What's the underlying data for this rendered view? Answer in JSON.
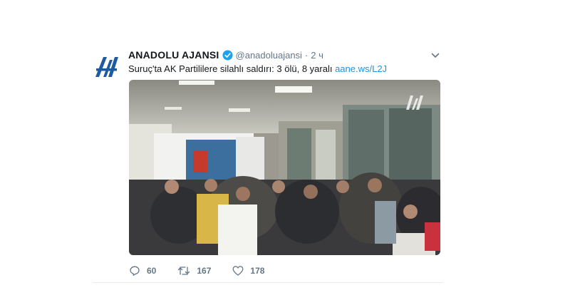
{
  "tweet": {
    "name": "ANADOLU AJANSI",
    "handle": "@anadoluajansi",
    "separator": "·",
    "time": "2 ч",
    "text": "Suruç'ta AK Partililere silahlı saldırı: 3 ölü, 8 yaralı ",
    "link": "aane.ws/L2J",
    "media_watermark": "AA",
    "counts": {
      "replies": "60",
      "retweets": "167",
      "likes": "178"
    }
  },
  "icons": {
    "avatar": "anadolu-agency-logo",
    "verified": "verified-badge-icon",
    "more": "chevron-down-icon",
    "reply": "reply-icon",
    "retweet": "retweet-icon",
    "like": "heart-icon"
  },
  "colors": {
    "link": "#1b95e0",
    "verified": "#1da1f2",
    "muted": "#657786",
    "logo": "#1e5aa0"
  }
}
